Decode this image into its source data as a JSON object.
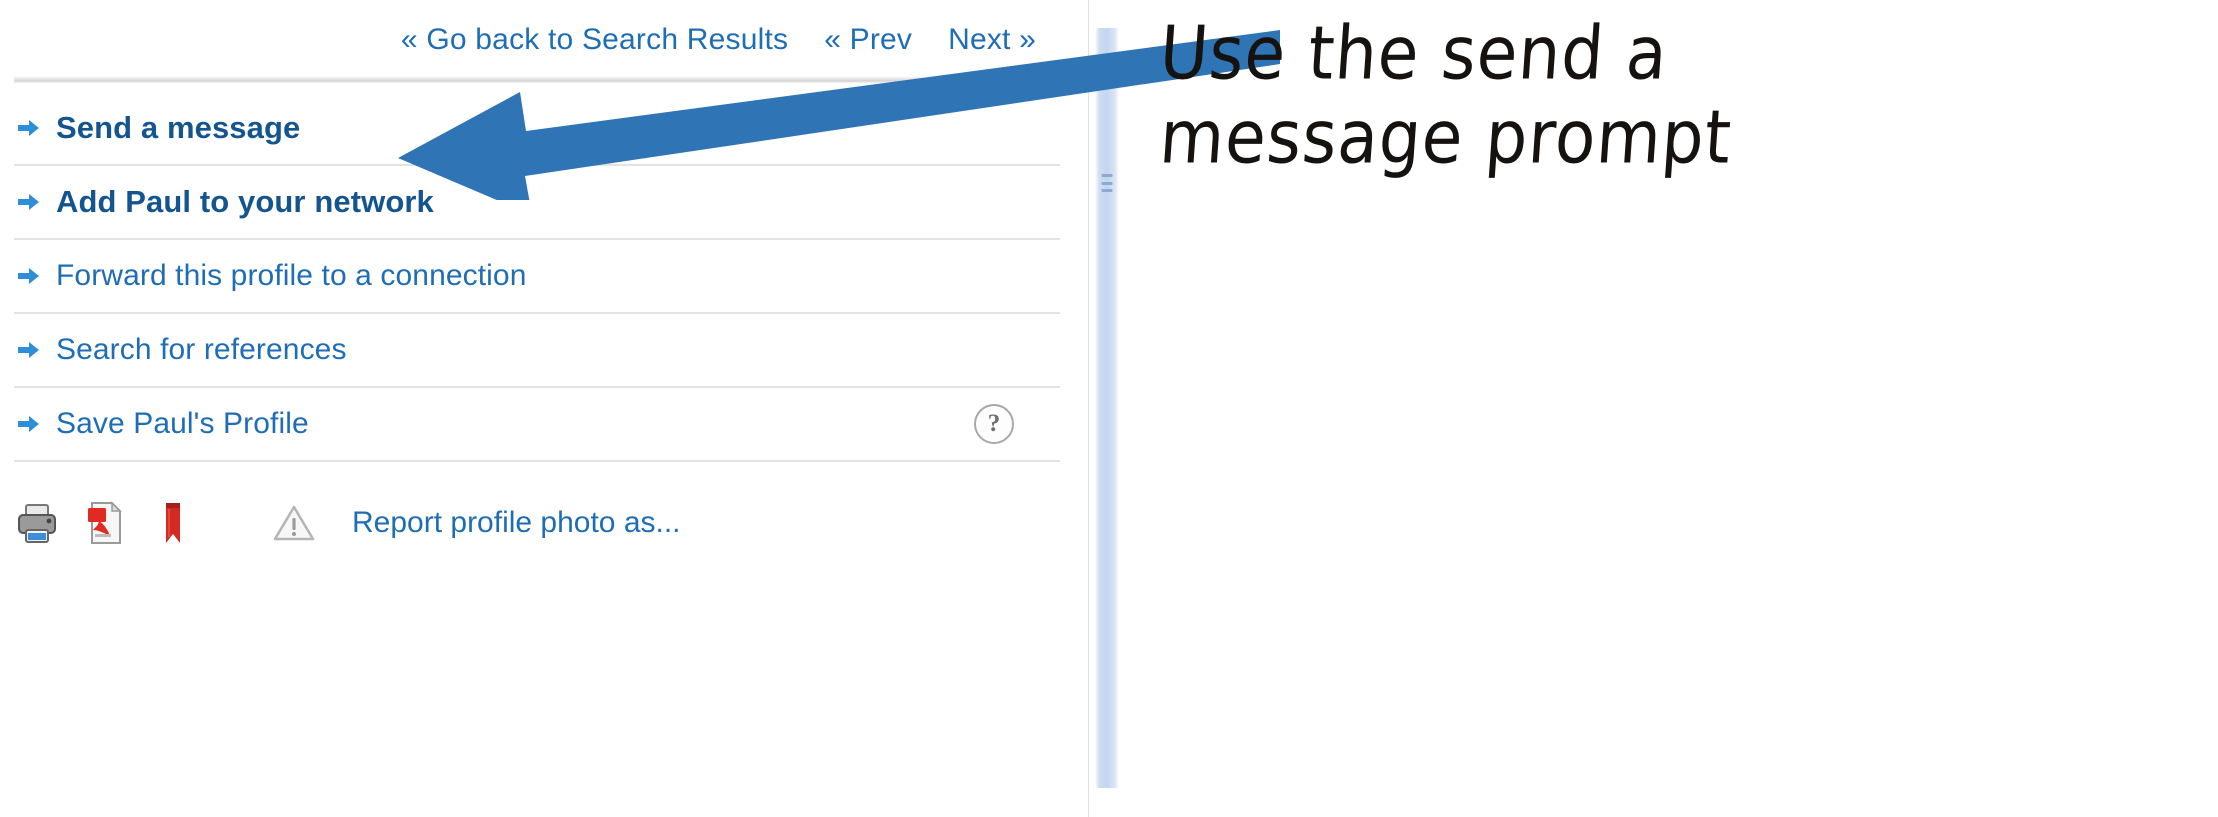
{
  "page": {
    "title": "LinkedIn profile action panel",
    "accent_blue": "#1f6eb5",
    "bold_blue": "#14558f",
    "annotation_arrow_color": "#2f74b5"
  },
  "profile_nav": {
    "links": [
      {
        "id": "go-back-to-search-results",
        "label": "« Go back to Search Results"
      },
      {
        "id": "prev",
        "label": "« Prev"
      },
      {
        "id": "next",
        "label": "Next »"
      }
    ]
  },
  "action_list": {
    "items": [
      {
        "id": "send-a-message",
        "label": "Send a message",
        "bold": true,
        "bullet_icon": "arrow-right-bullet-icon",
        "help_badge": null
      },
      {
        "id": "add-to-network",
        "label": "Add Paul to your network",
        "bold": true,
        "bullet_icon": "arrow-right-bullet-icon",
        "help_badge": null
      },
      {
        "id": "forward-profile",
        "label": "Forward this profile to a connection",
        "bold": false,
        "bullet_icon": "arrow-right-bullet-icon",
        "help_badge": null
      },
      {
        "id": "search-for-references",
        "label": "Search for references",
        "bold": false,
        "bullet_icon": "arrow-right-bullet-icon",
        "help_badge": null
      },
      {
        "id": "save-profile",
        "label": "Save Paul's Profile",
        "bold": false,
        "bullet_icon": "arrow-right-bullet-icon",
        "help_badge": "?"
      }
    ]
  },
  "utility_row": {
    "icons": [
      {
        "id": "print",
        "icon": "printer-icon"
      },
      {
        "id": "pdf",
        "icon": "pdf-icon"
      },
      {
        "id": "bookmark",
        "icon": "bookmark-icon"
      },
      {
        "id": "report",
        "icon": "warning-triangle-icon"
      }
    ],
    "report_label": "Report profile photo as..."
  },
  "scrollbar": {
    "orientation": "vertical",
    "grip_icon": "scrollbar-grip-icon"
  },
  "annotation": {
    "lines": [
      "Use the send a",
      "message prompt"
    ],
    "arrow_icon": "annotation-arrow-icon",
    "points_to": "send-a-message"
  }
}
